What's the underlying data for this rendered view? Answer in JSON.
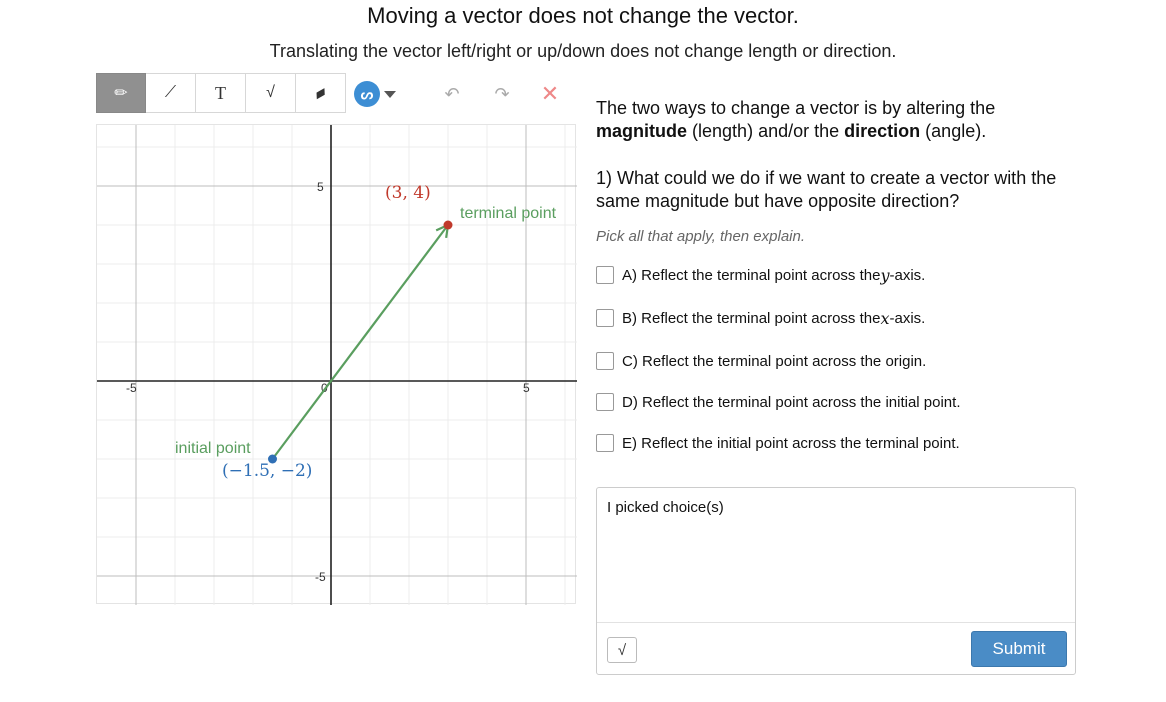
{
  "header": {
    "title": "Moving a vector does not change the vector.",
    "subtitle": "Translating the vector left/right or up/down does not change length or direction."
  },
  "toolbar": {
    "tools": [
      {
        "name": "pencil-icon",
        "glyph": "✏"
      },
      {
        "name": "line-segment-icon",
        "glyph": "⟋"
      },
      {
        "name": "text-icon",
        "glyph": "T"
      },
      {
        "name": "math-icon",
        "glyph": "√"
      },
      {
        "name": "eraser-icon",
        "glyph": "▰"
      }
    ],
    "color_glyph": "ᔕ",
    "undo_glyph": "↶",
    "redo_glyph": "↷",
    "clear_glyph": "✕",
    "accent_color": "#3d8ed4"
  },
  "graph": {
    "x_range": [
      -5,
      5
    ],
    "y_range": [
      -5,
      5
    ],
    "tick_labels": {
      "x_left": "-5",
      "x_right": "5",
      "y_top": "5",
      "y_bottom": "-5",
      "origin": "0"
    },
    "vector": {
      "initial": [
        -1.5,
        -2
      ],
      "terminal": [
        3,
        4
      ],
      "color": "#5a9e5f"
    },
    "initial_point_label": "initial point",
    "initial_point_coord": "(−1.5, −2)",
    "initial_point_color": "#2f6fb5",
    "terminal_point_label": "terminal point",
    "terminal_point_coord": "(3, 4)",
    "terminal_point_color": "#c0392b"
  },
  "question": {
    "intro_part1": "The two ways to change a vector is by altering the",
    "intro_bold1": "magnitude",
    "intro_mid": "(length) and/or the",
    "intro_bold2": "direction",
    "intro_end": "(angle).",
    "prompt": "1) What could we do if we want to create a vector with the same magnitude but have opposite direction?",
    "hint": "Pick all that apply, then explain.",
    "choices": [
      {
        "pre": "A) Reflect the terminal point across the ",
        "var": "y",
        "post": "-axis."
      },
      {
        "pre": "B) Reflect the terminal point across the ",
        "var": "x",
        "post": "-axis."
      },
      {
        "pre": "C) Reflect the terminal point across the origin.",
        "var": "",
        "post": ""
      },
      {
        "pre": "D) Reflect the terminal point across the initial point.",
        "var": "",
        "post": ""
      },
      {
        "pre": "E) Reflect the initial point across the terminal point.",
        "var": "",
        "post": ""
      }
    ]
  },
  "answer": {
    "text": "I picked choice(s)",
    "math_button": "√",
    "submit_label": "Submit"
  }
}
